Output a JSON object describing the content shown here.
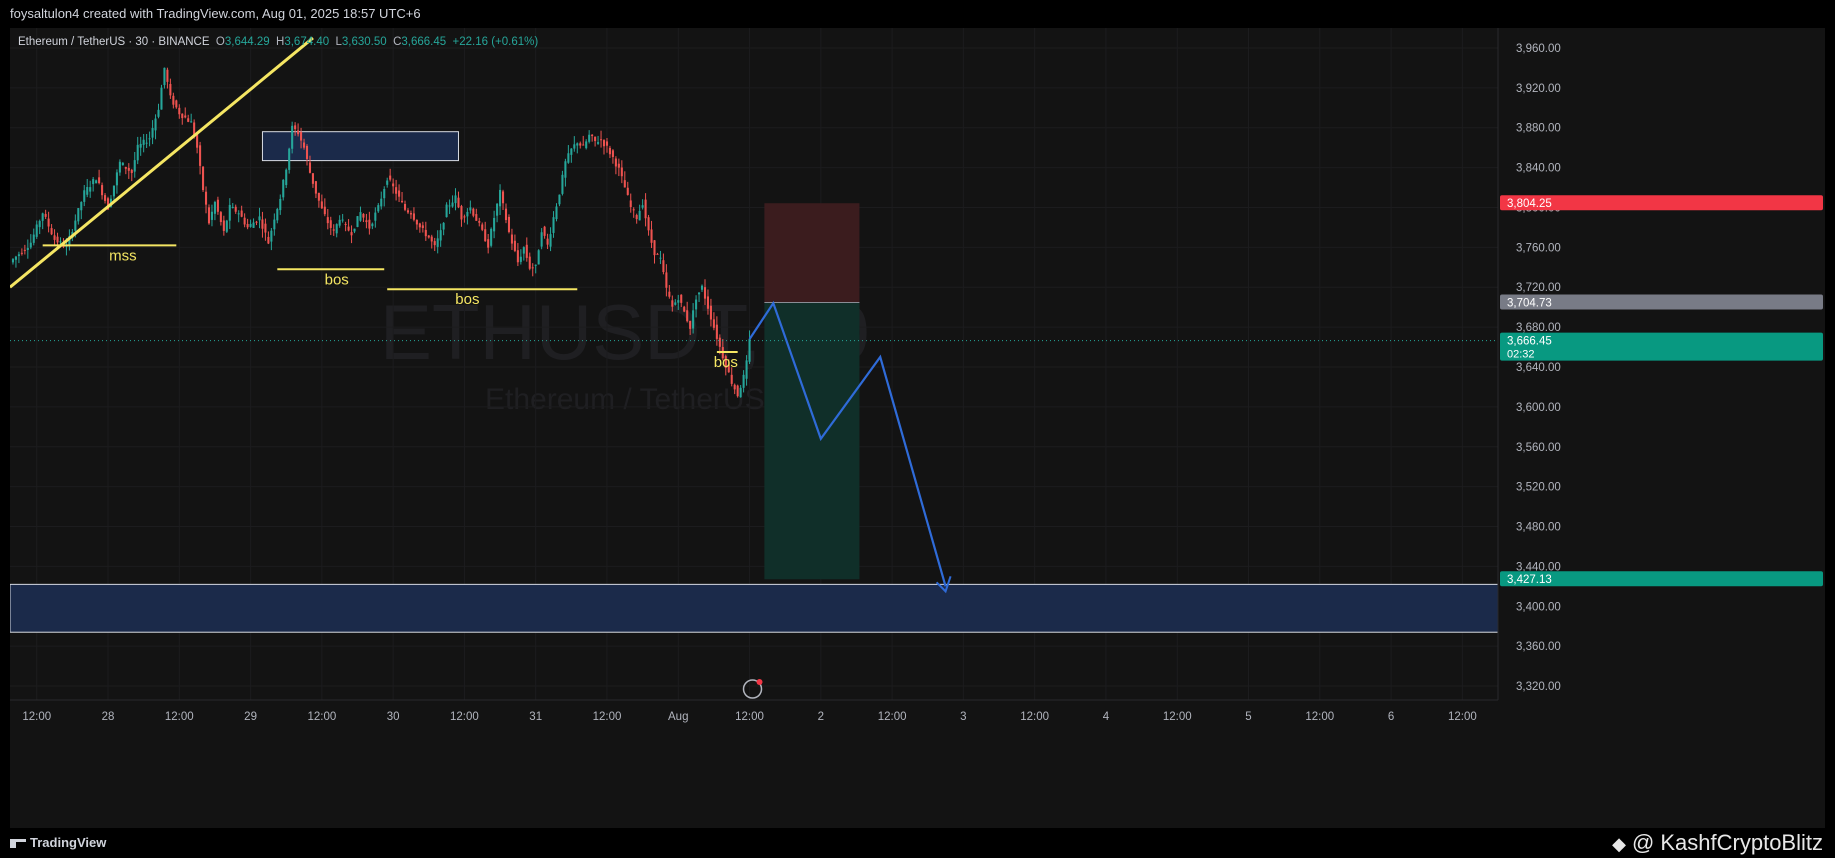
{
  "header": {
    "caption": "foysaltulon4 created with TradingView.com, Aug 01, 2025 18:57 UTC+6"
  },
  "legend": {
    "symbol": "Ethereum / TetherUS · 30 · BINANCE",
    "open_label": "O",
    "open": "3,644.29",
    "high_label": "H",
    "high": "3,674.40",
    "low_label": "L",
    "low": "3,630.50",
    "close_label": "C",
    "close": "3,666.45",
    "change": "+22.16 (+0.61%)"
  },
  "watermark": {
    "line1": "ETHUSDT, 30",
    "line2": "Ethereum / TetherUS"
  },
  "footer": {
    "brand": "TradingView",
    "credit": "@ KashfCryptoBlitz"
  },
  "price_tags": [
    {
      "value": "3,804.25",
      "sub": "",
      "color": "#f23645"
    },
    {
      "value": "3,704.73",
      "sub": "",
      "color": "#787b86"
    },
    {
      "value": "3,666.45",
      "sub": "02:32",
      "color": "#089981"
    },
    {
      "value": "3,427.13",
      "sub": "",
      "color": "#089981"
    }
  ],
  "annotations": [
    {
      "text": "mss",
      "color": "#f5e663"
    },
    {
      "text": "bos",
      "color": "#f5e663"
    },
    {
      "text": "bos",
      "color": "#f5e663"
    },
    {
      "text": "bos",
      "color": "#f5e663"
    }
  ],
  "colors": {
    "up": "#26a69a",
    "down": "#ef5350",
    "zone_fill": "#1b2a4a",
    "projection": "#2f6bd8",
    "trend": "#f5e663",
    "stop_zone": "#3d1c1f",
    "target_zone": "#10302a"
  },
  "chart_data": {
    "type": "candlestick",
    "symbol": "ETHUSDT",
    "interval": "30",
    "y_ticks": [
      "3,960.00",
      "3,920.00",
      "3,880.00",
      "3,840.00",
      "3,800.00",
      "3,760.00",
      "3,720.00",
      "3,680.00",
      "3,640.00",
      "3,600.00",
      "3,560.00",
      "3,520.00",
      "3,480.00",
      "3,440.00",
      "3,400.00",
      "3,360.00",
      "3,320.00"
    ],
    "y_tick_values": [
      3960,
      3920,
      3880,
      3840,
      3800,
      3760,
      3720,
      3680,
      3640,
      3600,
      3560,
      3520,
      3480,
      3440,
      3400,
      3360,
      3320
    ],
    "x_ticks": [
      {
        "label": "12:00",
        "h": -12
      },
      {
        "label": "28",
        "h": 0
      },
      {
        "label": "12:00",
        "h": 12
      },
      {
        "label": "29",
        "h": 24
      },
      {
        "label": "12:00",
        "h": 36
      },
      {
        "label": "30",
        "h": 48
      },
      {
        "label": "12:00",
        "h": 60
      },
      {
        "label": "31",
        "h": 72
      },
      {
        "label": "12:00",
        "h": 84
      },
      {
        "label": "Aug",
        "h": 96
      },
      {
        "label": "12:00",
        "h": 108
      },
      {
        "label": "2",
        "h": 120
      },
      {
        "label": "12:00",
        "h": 132
      },
      {
        "label": "3",
        "h": 144
      },
      {
        "label": "12:00",
        "h": 156
      },
      {
        "label": "4",
        "h": 168
      },
      {
        "label": "12:00",
        "h": 180
      },
      {
        "label": "5",
        "h": 192
      },
      {
        "label": "12:00",
        "h": 204
      },
      {
        "label": "6",
        "h": 216
      },
      {
        "label": "12:00",
        "h": 228
      }
    ],
    "y_range": [
      3300,
      3980
    ],
    "x_range_hours": [
      -16.5,
      234
    ],
    "anchors": [
      [
        -16.5,
        3745
      ],
      [
        -13,
        3765
      ],
      [
        -11,
        3795
      ],
      [
        -9,
        3768
      ],
      [
        -7,
        3760
      ],
      [
        -4,
        3815
      ],
      [
        -2,
        3830
      ],
      [
        0,
        3800
      ],
      [
        2,
        3845
      ],
      [
        4,
        3835
      ],
      [
        5,
        3860
      ],
      [
        7,
        3870
      ],
      [
        8.5,
        3900
      ],
      [
        9.5,
        3940
      ],
      [
        10.5,
        3910
      ],
      [
        12,
        3895
      ],
      [
        14,
        3885
      ],
      [
        15,
        3860
      ],
      [
        16,
        3818
      ],
      [
        17,
        3785
      ],
      [
        18,
        3805
      ],
      [
        19.5,
        3775
      ],
      [
        20.5,
        3800
      ],
      [
        22,
        3795
      ],
      [
        23.5,
        3780
      ],
      [
        25.5,
        3790
      ],
      [
        27,
        3765
      ],
      [
        28,
        3790
      ],
      [
        29,
        3810
      ],
      [
        30,
        3840
      ],
      [
        31,
        3880
      ],
      [
        32,
        3875
      ],
      [
        33,
        3860
      ],
      [
        34,
        3835
      ],
      [
        35,
        3815
      ],
      [
        36,
        3798
      ],
      [
        37,
        3785
      ],
      [
        38,
        3775
      ],
      [
        39,
        3790
      ],
      [
        40,
        3780
      ],
      [
        41,
        3775
      ],
      [
        42.5,
        3795
      ],
      [
        44,
        3780
      ],
      [
        45.5,
        3800
      ],
      [
        47,
        3830
      ],
      [
        48.5,
        3815
      ],
      [
        50,
        3798
      ],
      [
        51,
        3795
      ],
      [
        52.5,
        3780
      ],
      [
        54,
        3770
      ],
      [
        55,
        3760
      ],
      [
        56,
        3775
      ],
      [
        57,
        3800
      ],
      [
        58.5,
        3810
      ],
      [
        59.5,
        3790
      ],
      [
        61,
        3800
      ],
      [
        62.5,
        3782
      ],
      [
        64,
        3762
      ],
      [
        65,
        3790
      ],
      [
        66,
        3815
      ],
      [
        67.5,
        3775
      ],
      [
        69,
        3745
      ],
      [
        70,
        3760
      ],
      [
        71,
        3740
      ],
      [
        72,
        3740
      ],
      [
        73,
        3778
      ],
      [
        74,
        3762
      ],
      [
        75,
        3790
      ],
      [
        76,
        3815
      ],
      [
        77,
        3845
      ],
      [
        78,
        3858
      ],
      [
        79,
        3866
      ],
      [
        80,
        3860
      ],
      [
        81,
        3872
      ],
      [
        82,
        3866
      ],
      [
        83,
        3868
      ],
      [
        84,
        3860
      ],
      [
        85,
        3850
      ],
      [
        86,
        3838
      ],
      [
        87,
        3820
      ],
      [
        88,
        3800
      ],
      [
        89,
        3790
      ],
      [
        90,
        3805
      ],
      [
        91,
        3775
      ],
      [
        92,
        3755
      ],
      [
        93,
        3748
      ],
      [
        94,
        3718
      ],
      [
        95,
        3700
      ],
      [
        96,
        3710
      ],
      [
        97,
        3695
      ],
      [
        98,
        3680
      ],
      [
        99,
        3710
      ],
      [
        100,
        3720
      ],
      [
        101,
        3700
      ],
      [
        102,
        3680
      ],
      [
        103,
        3660
      ],
      [
        104,
        3642
      ],
      [
        105,
        3625
      ],
      [
        106,
        3612
      ],
      [
        107,
        3630
      ],
      [
        107.5,
        3644
      ],
      [
        108,
        3666
      ]
    ],
    "zones": [
      {
        "h1": 26,
        "h2": 59,
        "top": 3876,
        "bottom": 3847
      },
      {
        "h1": -16.5,
        "h2": 234,
        "top": 3422,
        "bottom": 3374
      }
    ],
    "trendline": [
      [
        -16.5,
        3720
      ],
      [
        34.5,
        3970
      ]
    ],
    "levels": [
      {
        "h1": -11,
        "h2": 11.5,
        "price": 3762,
        "label_h": 2.5
      },
      {
        "h1": 28.5,
        "h2": 46.5,
        "price": 3738,
        "label_h": 38.5
      },
      {
        "h1": 47,
        "h2": 79,
        "price": 3718,
        "label_h": 60.5
      },
      {
        "h1": 102.5,
        "h2": 106,
        "price": 3655,
        "label_h": 104
      }
    ],
    "position": {
      "h1": 110.5,
      "h2": 126.5,
      "entry": 3704.73,
      "stop": 3804.25,
      "target": 3427.13
    },
    "projection": [
      [
        108,
        3668
      ],
      [
        112,
        3704
      ],
      [
        120,
        3568
      ],
      [
        130,
        3650
      ],
      [
        141,
        3420
      ]
    ],
    "current_price": 3666.45
  }
}
